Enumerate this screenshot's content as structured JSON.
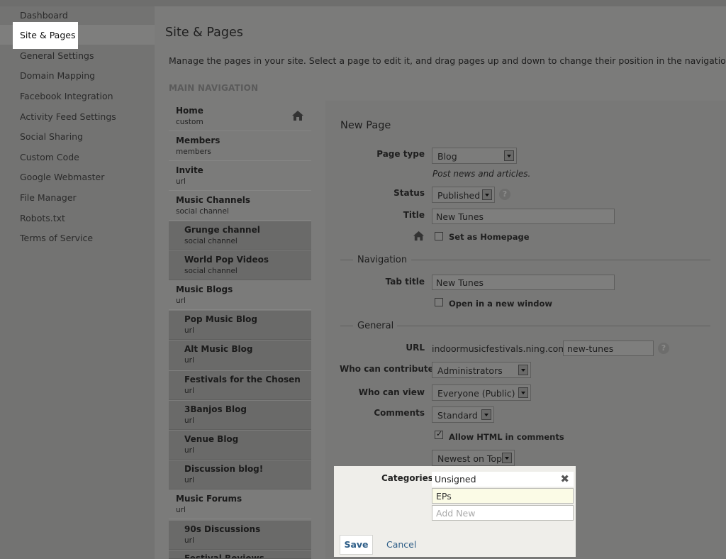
{
  "sidebar": {
    "items": [
      "Dashboard",
      "Site & Pages",
      "General Settings",
      "Domain Mapping",
      "Facebook Integration",
      "Activity Feed Settings",
      "Social Sharing",
      "Custom Code",
      "Google Webmaster",
      "File Manager",
      "Robots.txt",
      "Terms of Service"
    ],
    "active": "Site & Pages"
  },
  "page": {
    "title": "Site & Pages",
    "description": "Manage the pages in your site. Select a page to edit it, and drag pages up and down to change their position in the navigation menu.",
    "nav_heading": "MAIN NAVIGATION"
  },
  "nav_items": [
    {
      "title": "Home",
      "type": "custom",
      "sub": false,
      "home": true
    },
    {
      "title": "Members",
      "type": "members",
      "sub": false
    },
    {
      "title": "Invite",
      "type": "url",
      "sub": false
    },
    {
      "title": "Music Channels",
      "type": "social channel",
      "sub": false
    },
    {
      "title": "Grunge channel",
      "type": "social channel",
      "sub": true
    },
    {
      "title": "World Pop Videos",
      "type": "social channel",
      "sub": true
    },
    {
      "title": "Music Blogs",
      "type": "url",
      "sub": false
    },
    {
      "title": "Pop Music Blog",
      "type": "url",
      "sub": true
    },
    {
      "title": "Alt Music Blog",
      "type": "url",
      "sub": true
    },
    {
      "title": "Festivals for the Chosen",
      "type": "url",
      "sub": true
    },
    {
      "title": "3Banjos Blog",
      "type": "url",
      "sub": true
    },
    {
      "title": "Venue Blog",
      "type": "url",
      "sub": true
    },
    {
      "title": "Discussion blog!",
      "type": "url",
      "sub": true
    },
    {
      "title": "Music Forums",
      "type": "url",
      "sub": false
    },
    {
      "title": "90s Discussions",
      "type": "url",
      "sub": true
    },
    {
      "title": "Festival Reviews",
      "type": "",
      "sub": true
    }
  ],
  "form": {
    "title": "New Page",
    "page_type_label": "Page type",
    "page_type_value": "Blog",
    "page_type_help": "Post news and articles.",
    "status_label": "Status",
    "status_value": "Published",
    "title_label": "Title",
    "title_value": "New Tunes",
    "homepage_label": "Set as Homepage",
    "navigation_section": "Navigation",
    "tab_title_label": "Tab title",
    "tab_title_value": "New Tunes",
    "new_window_label": "Open in a new window",
    "general_section": "General",
    "url_label": "URL",
    "url_prefix": "indoormusicfestivals.ning.com/",
    "url_value": "new-tunes",
    "contribute_label": "Who can contribute",
    "contribute_value": "Administrators",
    "view_label": "Who can view",
    "view_value": "Everyone (Public)",
    "comments_label": "Comments",
    "comments_value": "Standard",
    "allow_html_label": "Allow HTML in comments",
    "sort_value": "Newest on Top",
    "help_glyph": "?"
  },
  "categories": {
    "label": "Categories",
    "items": [
      "Unsigned",
      "EPs"
    ],
    "add_placeholder": "Add New",
    "remove_glyph": "✖",
    "save_label": "Save",
    "cancel_label": "Cancel"
  }
}
